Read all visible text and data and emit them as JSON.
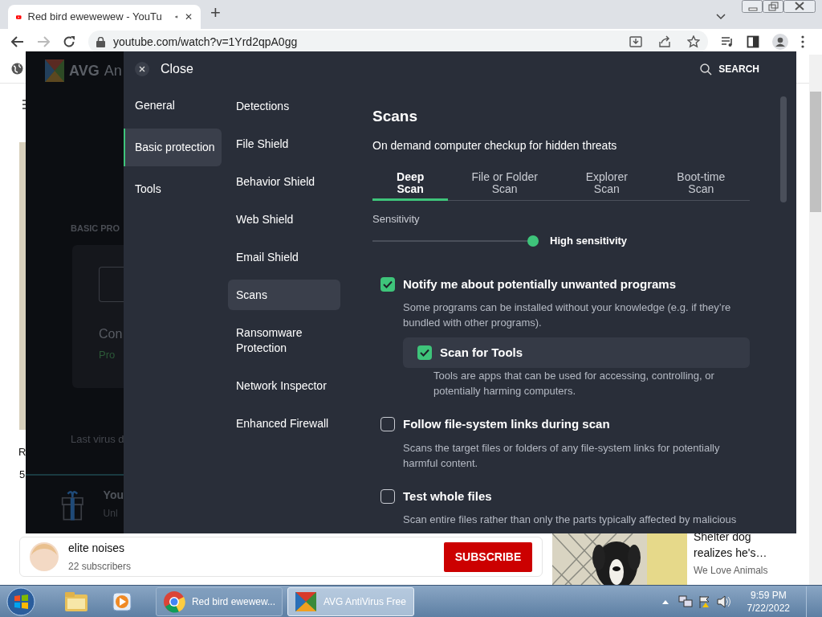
{
  "browser": {
    "tab": {
      "title": "Red bird ewewewew - YouTu",
      "close": "✕"
    },
    "new_tab": "+",
    "url": "youtube.com/watch?v=1Yrd2qpA0gg"
  },
  "page": {
    "video_title": "R",
    "video_meta": "5",
    "channel": {
      "name": "elite noises",
      "subscribers": "22 subscribers",
      "subscribe": "SUBSCRIBE"
    },
    "recommendation": {
      "title_lines": [
        "Shelter dog",
        "realizes he's…"
      ],
      "channel": "We Love Animals"
    }
  },
  "avg_app": {
    "logo": "AVG",
    "name": "An",
    "section": "BASIC PRO",
    "card_title": "Con",
    "card_status": "Pro",
    "last_scan": "Last virus d",
    "promo_title": "You",
    "promo_sub": "Unl"
  },
  "settings": {
    "close": "Close",
    "search": "SEARCH",
    "categories": [
      {
        "label": "General",
        "selected": false
      },
      {
        "label": "Basic protection",
        "selected": true
      },
      {
        "label": "Tools",
        "selected": false
      }
    ],
    "subcategories": [
      {
        "label": "Detections",
        "selected": false
      },
      {
        "label": "File Shield",
        "selected": false
      },
      {
        "label": "Behavior Shield",
        "selected": false
      },
      {
        "label": "Web Shield",
        "selected": false
      },
      {
        "label": "Email Shield",
        "selected": false
      },
      {
        "label": "Scans",
        "selected": true
      },
      {
        "label": "Ransomware Protection",
        "selected": false
      },
      {
        "label": "Network Inspector",
        "selected": false
      },
      {
        "label": "Enhanced Firewall",
        "selected": false
      }
    ],
    "title": "Scans",
    "subtitle": "On demand computer checkup for hidden threats",
    "tabs": [
      {
        "label": "Deep Scan",
        "selected": true
      },
      {
        "label": "File or Folder Scan",
        "selected": false
      },
      {
        "label": "Explorer Scan",
        "selected": false
      },
      {
        "label": "Boot-time Scan",
        "selected": false
      }
    ],
    "sensitivity": {
      "label": "Sensitivity",
      "level": 1,
      "reading": "High sensitivity"
    },
    "options": [
      {
        "label": "Notify me about potentially unwanted programs",
        "description": "Some programs can be installed without your knowledge (e.g. if they’re bundled with other programs).",
        "checked": true,
        "children": [
          {
            "label": "Scan for Tools",
            "description": "Tools are apps that can be used for accessing, controlling, or potentially harming computers.",
            "checked": true
          }
        ]
      },
      {
        "label": "Follow file-system links during scan",
        "description": "Scans the target files or folders of any file-system links for potentially harmful content.",
        "checked": false
      },
      {
        "label": "Test whole files",
        "description": "Scan entire files rather than only the parts typically affected by malicious",
        "checked": false
      }
    ]
  },
  "taskbar": {
    "items": [
      {
        "label": "Red bird ewewew...",
        "kind": "chrome",
        "selected": false
      },
      {
        "label": "AVG AntiVirus Free",
        "kind": "avg",
        "selected": true
      }
    ],
    "time": "9:59 PM",
    "date": "7/22/2022"
  }
}
